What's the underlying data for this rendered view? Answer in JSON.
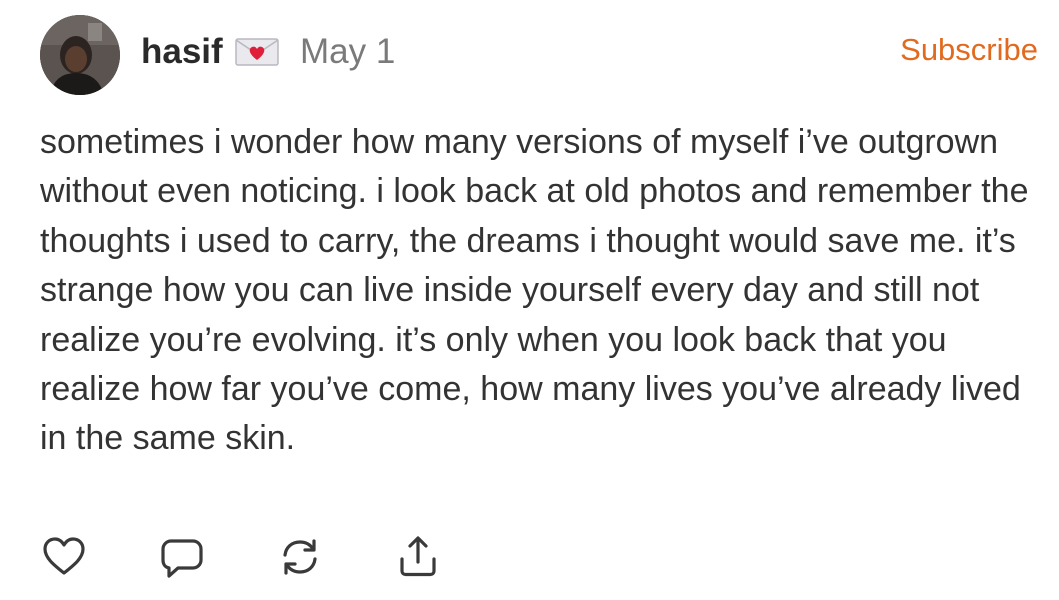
{
  "post": {
    "author": {
      "name": "hasif",
      "avatar_icon": "avatar-photo"
    },
    "badge_icon": "love-letter-icon",
    "date": "May 1",
    "subscribe_label": "Subscribe",
    "body": "sometimes i wonder how many versions of myself i’ve outgrown without even noticing. i look back at old photos and remember the thoughts i used to carry, the dreams i thought would save me. it’s strange how you can live inside yourself every day and still not realize you’re evolving. it’s only when you look back that you realize how far you’ve come, how many lives you’ve already lived in the same skin.",
    "actions": [
      {
        "name": "like",
        "icon": "heart-icon"
      },
      {
        "name": "comment",
        "icon": "comment-icon"
      },
      {
        "name": "restack",
        "icon": "restack-icon"
      },
      {
        "name": "share",
        "icon": "share-icon"
      }
    ]
  },
  "colors": {
    "accent": "#e26a1f",
    "text": "#333333",
    "muted": "#7a7a7a",
    "icon": "#3a3a3a"
  }
}
